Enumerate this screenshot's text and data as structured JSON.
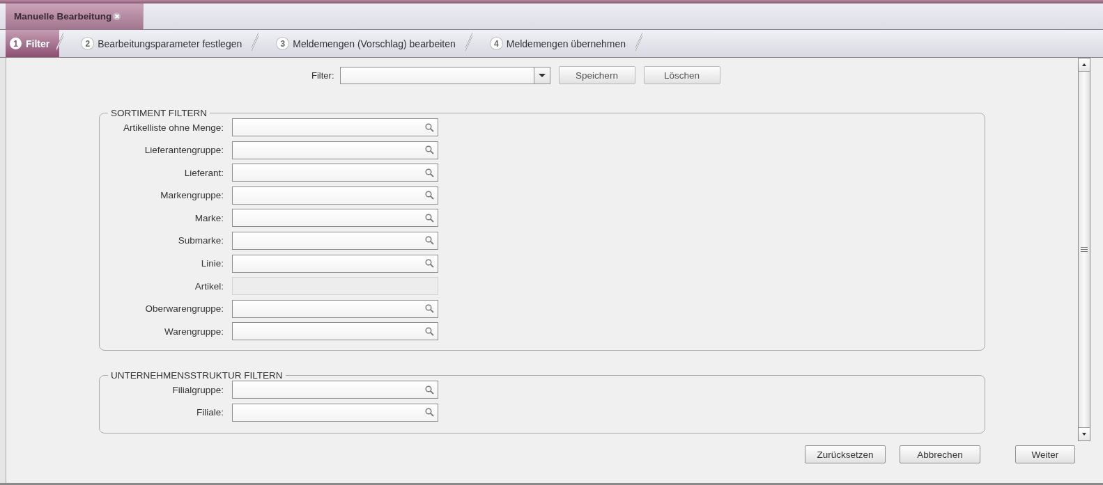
{
  "document_tab": {
    "title": "Manuelle Bearbeitung",
    "selected": true
  },
  "steps": [
    {
      "number": "1",
      "label": "Filter",
      "selected": true
    },
    {
      "number": "2",
      "label": "Bearbeitungsparameter festlegen",
      "selected": false
    },
    {
      "number": "3",
      "label": "Meldemengen (Vorschlag) bearbeiten",
      "selected": false
    },
    {
      "number": "4",
      "label": "Meldemengen übernehmen",
      "selected": false
    }
  ],
  "filter_bar": {
    "label": "Filter:",
    "buttons": [
      {
        "label": "Speichern",
        "disabled": true
      },
      {
        "label": "Löschen",
        "disabled": true
      }
    ]
  },
  "groups": [
    {
      "title": "SORTIMENT FILTERN",
      "fields": [
        {
          "label": "Artikelliste ohne Menge:",
          "disabled": false
        },
        {
          "label": "Lieferantengruppe:",
          "disabled": false
        },
        {
          "label": "Lieferant:",
          "disabled": false
        },
        {
          "label": "Markengruppe:",
          "disabled": false
        },
        {
          "label": "Marke:",
          "disabled": false
        },
        {
          "label": "Submarke:",
          "disabled": false
        },
        {
          "label": "Linie:",
          "disabled": false
        },
        {
          "label": "Artikel:",
          "disabled": true
        },
        {
          "label": "Oberwarengruppe:",
          "disabled": false
        },
        {
          "label": "Warengruppe:",
          "disabled": false
        }
      ]
    },
    {
      "title": "UNTERNEHMENSSTRUKTUR FILTERN",
      "fields": [
        {
          "label": "Filialgruppe:",
          "disabled": false
        },
        {
          "label": "Filiale:",
          "disabled": false
        }
      ]
    }
  ],
  "footer_buttons": [
    {
      "label": "Zurücksetzen"
    },
    {
      "label": "Abbrechen"
    },
    {
      "label": "Weiter"
    }
  ]
}
